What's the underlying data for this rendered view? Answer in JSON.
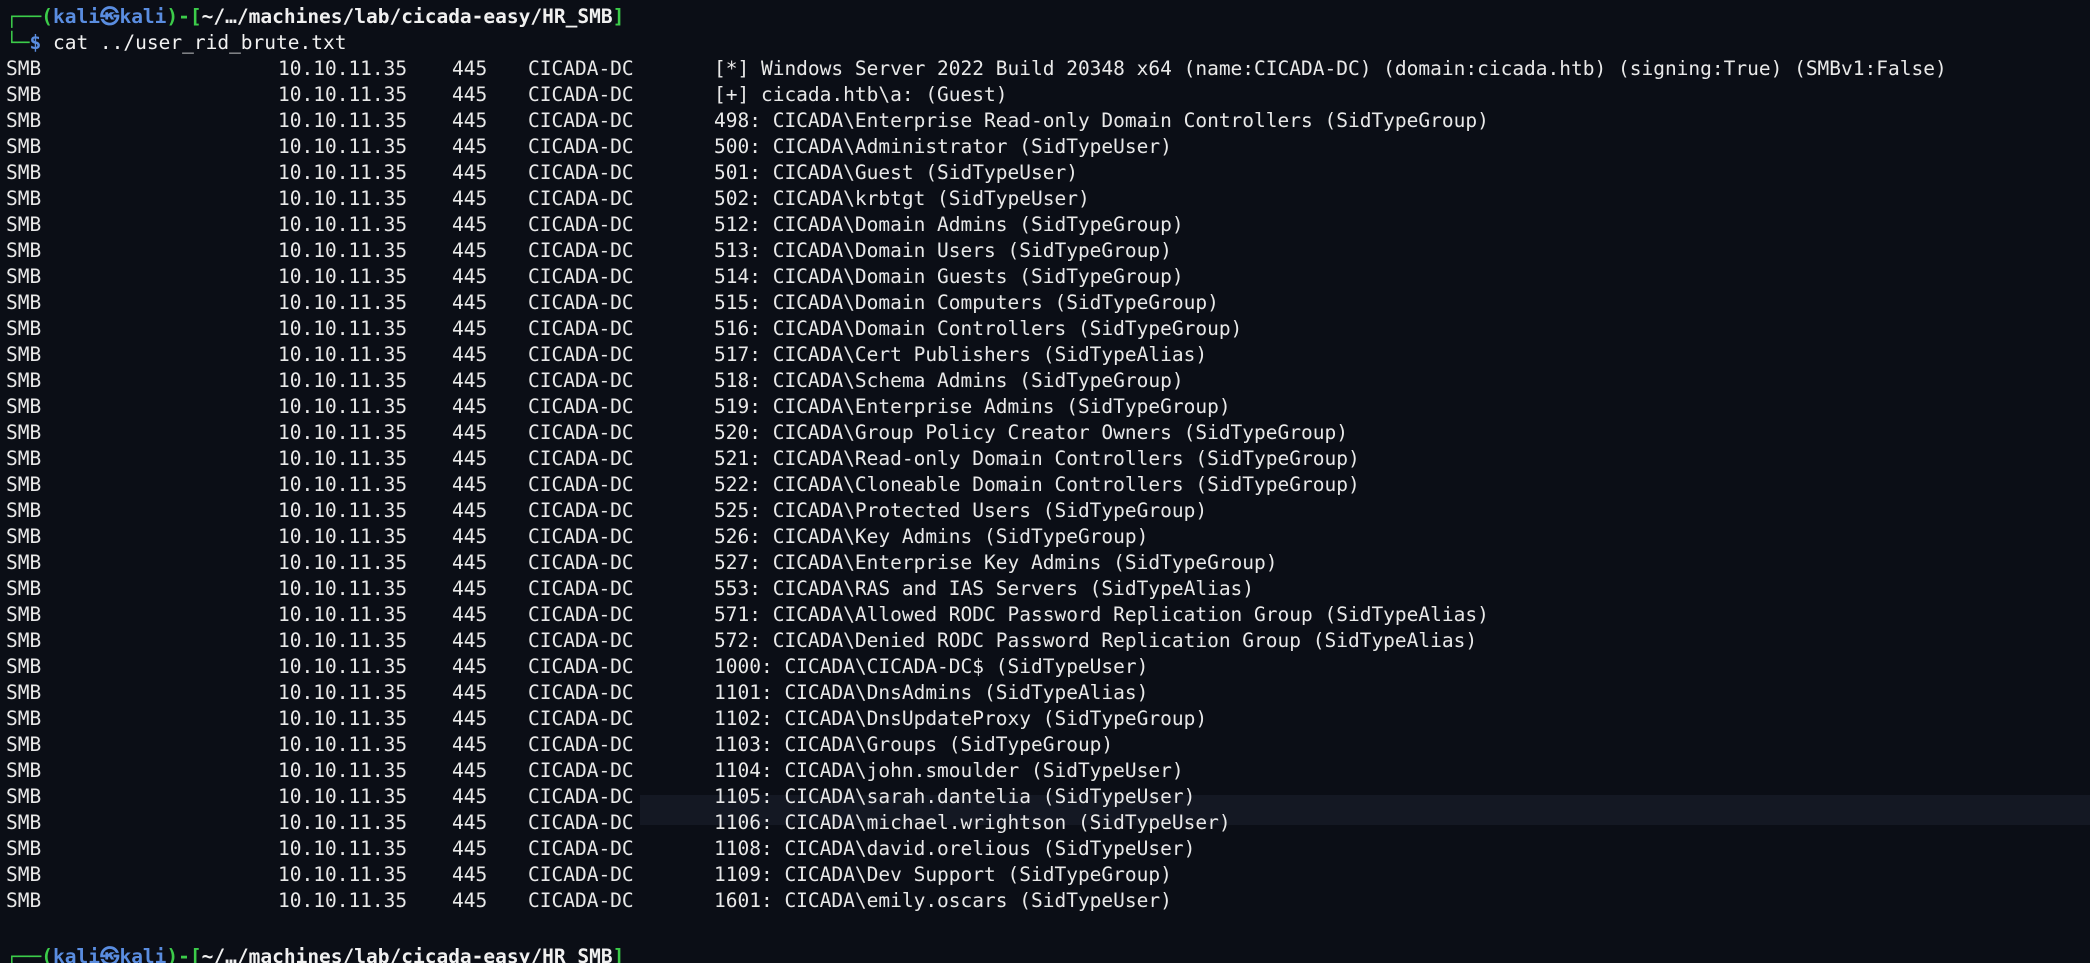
{
  "prompt": {
    "top_prefix": "┌──(",
    "user": "kali",
    "at": "㉿",
    "host": "kali",
    "mid": ")-[",
    "path": "~/…/machines/lab/cicada-easy/HR_SMB",
    "close": "]",
    "bottom_prefix": "└─",
    "dollar": "$ ",
    "command": "cat ../user_rid_brute.txt"
  },
  "output": {
    "rows": [
      {
        "proto": "SMB",
        "ip": "10.10.11.35",
        "port": "445",
        "host": "CICADA-DC",
        "msg": "[*] Windows Server 2022 Build 20348 x64 (name:CICADA-DC) (domain:cicada.htb) (signing:True) (SMBv1:False)"
      },
      {
        "proto": "SMB",
        "ip": "10.10.11.35",
        "port": "445",
        "host": "CICADA-DC",
        "msg": "[+] cicada.htb\\a: (Guest)"
      },
      {
        "proto": "SMB",
        "ip": "10.10.11.35",
        "port": "445",
        "host": "CICADA-DC",
        "msg": "498: CICADA\\Enterprise Read-only Domain Controllers (SidTypeGroup)"
      },
      {
        "proto": "SMB",
        "ip": "10.10.11.35",
        "port": "445",
        "host": "CICADA-DC",
        "msg": "500: CICADA\\Administrator (SidTypeUser)"
      },
      {
        "proto": "SMB",
        "ip": "10.10.11.35",
        "port": "445",
        "host": "CICADA-DC",
        "msg": "501: CICADA\\Guest (SidTypeUser)"
      },
      {
        "proto": "SMB",
        "ip": "10.10.11.35",
        "port": "445",
        "host": "CICADA-DC",
        "msg": "502: CICADA\\krbtgt (SidTypeUser)"
      },
      {
        "proto": "SMB",
        "ip": "10.10.11.35",
        "port": "445",
        "host": "CICADA-DC",
        "msg": "512: CICADA\\Domain Admins (SidTypeGroup)"
      },
      {
        "proto": "SMB",
        "ip": "10.10.11.35",
        "port": "445",
        "host": "CICADA-DC",
        "msg": "513: CICADA\\Domain Users (SidTypeGroup)"
      },
      {
        "proto": "SMB",
        "ip": "10.10.11.35",
        "port": "445",
        "host": "CICADA-DC",
        "msg": "514: CICADA\\Domain Guests (SidTypeGroup)"
      },
      {
        "proto": "SMB",
        "ip": "10.10.11.35",
        "port": "445",
        "host": "CICADA-DC",
        "msg": "515: CICADA\\Domain Computers (SidTypeGroup)"
      },
      {
        "proto": "SMB",
        "ip": "10.10.11.35",
        "port": "445",
        "host": "CICADA-DC",
        "msg": "516: CICADA\\Domain Controllers (SidTypeGroup)"
      },
      {
        "proto": "SMB",
        "ip": "10.10.11.35",
        "port": "445",
        "host": "CICADA-DC",
        "msg": "517: CICADA\\Cert Publishers (SidTypeAlias)"
      },
      {
        "proto": "SMB",
        "ip": "10.10.11.35",
        "port": "445",
        "host": "CICADA-DC",
        "msg": "518: CICADA\\Schema Admins (SidTypeGroup)"
      },
      {
        "proto": "SMB",
        "ip": "10.10.11.35",
        "port": "445",
        "host": "CICADA-DC",
        "msg": "519: CICADA\\Enterprise Admins (SidTypeGroup)"
      },
      {
        "proto": "SMB",
        "ip": "10.10.11.35",
        "port": "445",
        "host": "CICADA-DC",
        "msg": "520: CICADA\\Group Policy Creator Owners (SidTypeGroup)"
      },
      {
        "proto": "SMB",
        "ip": "10.10.11.35",
        "port": "445",
        "host": "CICADA-DC",
        "msg": "521: CICADA\\Read-only Domain Controllers (SidTypeGroup)"
      },
      {
        "proto": "SMB",
        "ip": "10.10.11.35",
        "port": "445",
        "host": "CICADA-DC",
        "msg": "522: CICADA\\Cloneable Domain Controllers (SidTypeGroup)"
      },
      {
        "proto": "SMB",
        "ip": "10.10.11.35",
        "port": "445",
        "host": "CICADA-DC",
        "msg": "525: CICADA\\Protected Users (SidTypeGroup)"
      },
      {
        "proto": "SMB",
        "ip": "10.10.11.35",
        "port": "445",
        "host": "CICADA-DC",
        "msg": "526: CICADA\\Key Admins (SidTypeGroup)"
      },
      {
        "proto": "SMB",
        "ip": "10.10.11.35",
        "port": "445",
        "host": "CICADA-DC",
        "msg": "527: CICADA\\Enterprise Key Admins (SidTypeGroup)"
      },
      {
        "proto": "SMB",
        "ip": "10.10.11.35",
        "port": "445",
        "host": "CICADA-DC",
        "msg": "553: CICADA\\RAS and IAS Servers (SidTypeAlias)"
      },
      {
        "proto": "SMB",
        "ip": "10.10.11.35",
        "port": "445",
        "host": "CICADA-DC",
        "msg": "571: CICADA\\Allowed RODC Password Replication Group (SidTypeAlias)"
      },
      {
        "proto": "SMB",
        "ip": "10.10.11.35",
        "port": "445",
        "host": "CICADA-DC",
        "msg": "572: CICADA\\Denied RODC Password Replication Group (SidTypeAlias)"
      },
      {
        "proto": "SMB",
        "ip": "10.10.11.35",
        "port": "445",
        "host": "CICADA-DC",
        "msg": "1000: CICADA\\CICADA-DC$ (SidTypeUser)"
      },
      {
        "proto": "SMB",
        "ip": "10.10.11.35",
        "port": "445",
        "host": "CICADA-DC",
        "msg": "1101: CICADA\\DnsAdmins (SidTypeAlias)"
      },
      {
        "proto": "SMB",
        "ip": "10.10.11.35",
        "port": "445",
        "host": "CICADA-DC",
        "msg": "1102: CICADA\\DnsUpdateProxy (SidTypeGroup)"
      },
      {
        "proto": "SMB",
        "ip": "10.10.11.35",
        "port": "445",
        "host": "CICADA-DC",
        "msg": "1103: CICADA\\Groups (SidTypeGroup)"
      },
      {
        "proto": "SMB",
        "ip": "10.10.11.35",
        "port": "445",
        "host": "CICADA-DC",
        "msg": "1104: CICADA\\john.smoulder (SidTypeUser)"
      },
      {
        "proto": "SMB",
        "ip": "10.10.11.35",
        "port": "445",
        "host": "CICADA-DC",
        "msg": "1105: CICADA\\sarah.dantelia (SidTypeUser)"
      },
      {
        "proto": "SMB",
        "ip": "10.10.11.35",
        "port": "445",
        "host": "CICADA-DC",
        "msg": "1106: CICADA\\michael.wrightson (SidTypeUser)"
      },
      {
        "proto": "SMB",
        "ip": "10.10.11.35",
        "port": "445",
        "host": "CICADA-DC",
        "msg": "1108: CICADA\\david.orelious (SidTypeUser)"
      },
      {
        "proto": "SMB",
        "ip": "10.10.11.35",
        "port": "445",
        "host": "CICADA-DC",
        "msg": "1109: CICADA\\Dev Support (SidTypeGroup)"
      },
      {
        "proto": "SMB",
        "ip": "10.10.11.35",
        "port": "445",
        "host": "CICADA-DC",
        "msg": "1601: CICADA\\emily.oscars (SidTypeUser)"
      }
    ]
  },
  "colors": {
    "background": "#0b0e16",
    "prompt_green": "#3ccc4a",
    "prompt_blue": "#5a8de0",
    "text": "#e9e9e9"
  }
}
